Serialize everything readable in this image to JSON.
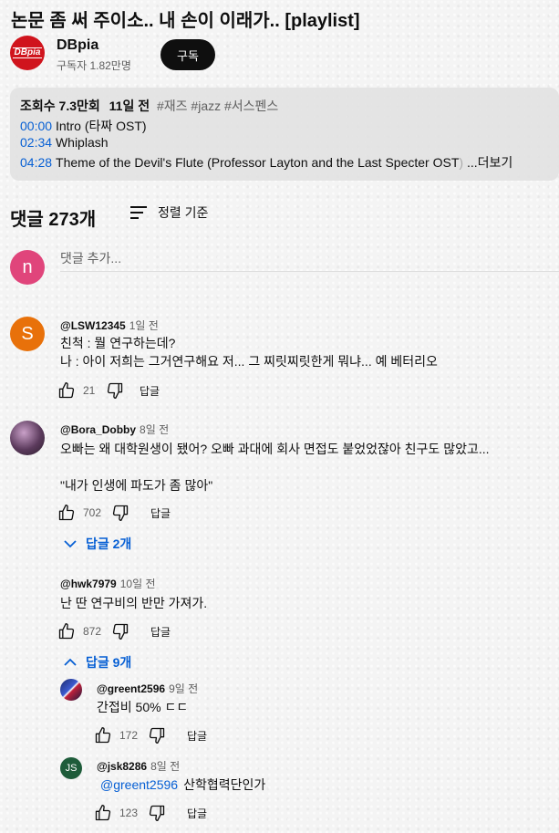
{
  "video": {
    "title": "논문 좀 써 주이소.. 내 손이 이래가.. [playlist]",
    "channel": {
      "name": "DBpia",
      "logo_text": "DBpia",
      "subscribers": "구독자 1.82만명",
      "subscribe_label": "구독"
    },
    "description": {
      "views": "조회수 7.3만회",
      "age": "11일 전",
      "tags": "#재즈 #jazz #서스펜스",
      "tracks": [
        {
          "time": "00:00",
          "title": "Intro (타짜 OST)"
        },
        {
          "time": "02:34",
          "title": "Whiplash"
        },
        {
          "time": "04:28",
          "title": "Theme of the Devil's Flute (Professor Layton and the Last Specter OST",
          "faded": ")",
          "more": "...더보기"
        }
      ]
    }
  },
  "comments_header": {
    "count": "댓글 273개",
    "sort_label": "정렬 기준"
  },
  "add_comment": {
    "avatar_letter": "n",
    "placeholder": "댓글 추가..."
  },
  "comments": [
    {
      "avatar_letter": "S",
      "avatar_color": "#e8710a",
      "author": "@LSW12345",
      "time": "1일 전",
      "lines": [
        "친척 : 뭘 연구하는데?",
        "나 : 아이 저희는 그거연구해요 저... 그 찌릿찌릿한게 뭐냐... 예 베터리오"
      ],
      "likes": "21",
      "reply_label": "답글"
    },
    {
      "author": "@Bora_Dobby",
      "time": "8일 전",
      "lines": [
        "오빠는 왜 대학원생이 됐어? 오빠 과대에 회사 면접도 붙었었잖아 친구도 많았고...",
        "",
        "\"내가 인생에 파도가 좀 많아\""
      ],
      "likes": "702",
      "reply_label": "답글",
      "replies_toggle": "답글 2개"
    },
    {
      "author": "@hwk7979",
      "time": "10일 전",
      "lines": [
        "난 딴 연구비의 반만 가져가."
      ],
      "likes": "872",
      "reply_label": "답글",
      "replies_toggle": "답글 9개",
      "replies": [
        {
          "author": "@greent2596",
          "time": "9일 전",
          "text": "간접비 50% ㄷㄷ",
          "likes": "172",
          "reply_label": "답글"
        },
        {
          "author": "@jsk8286",
          "time": "8일 전",
          "avatar_letter": "JS",
          "avatar_color": "#1e5c3a",
          "mention": "@greent2596",
          "text": "산학협력단인가",
          "likes": "123",
          "reply_label": "답글"
        }
      ]
    }
  ],
  "colors": {
    "accent": "#065fd4",
    "subscribe_bg": "#0f0f0f",
    "brand_red": "#d0141d",
    "add_avatar": "#e0457b"
  }
}
